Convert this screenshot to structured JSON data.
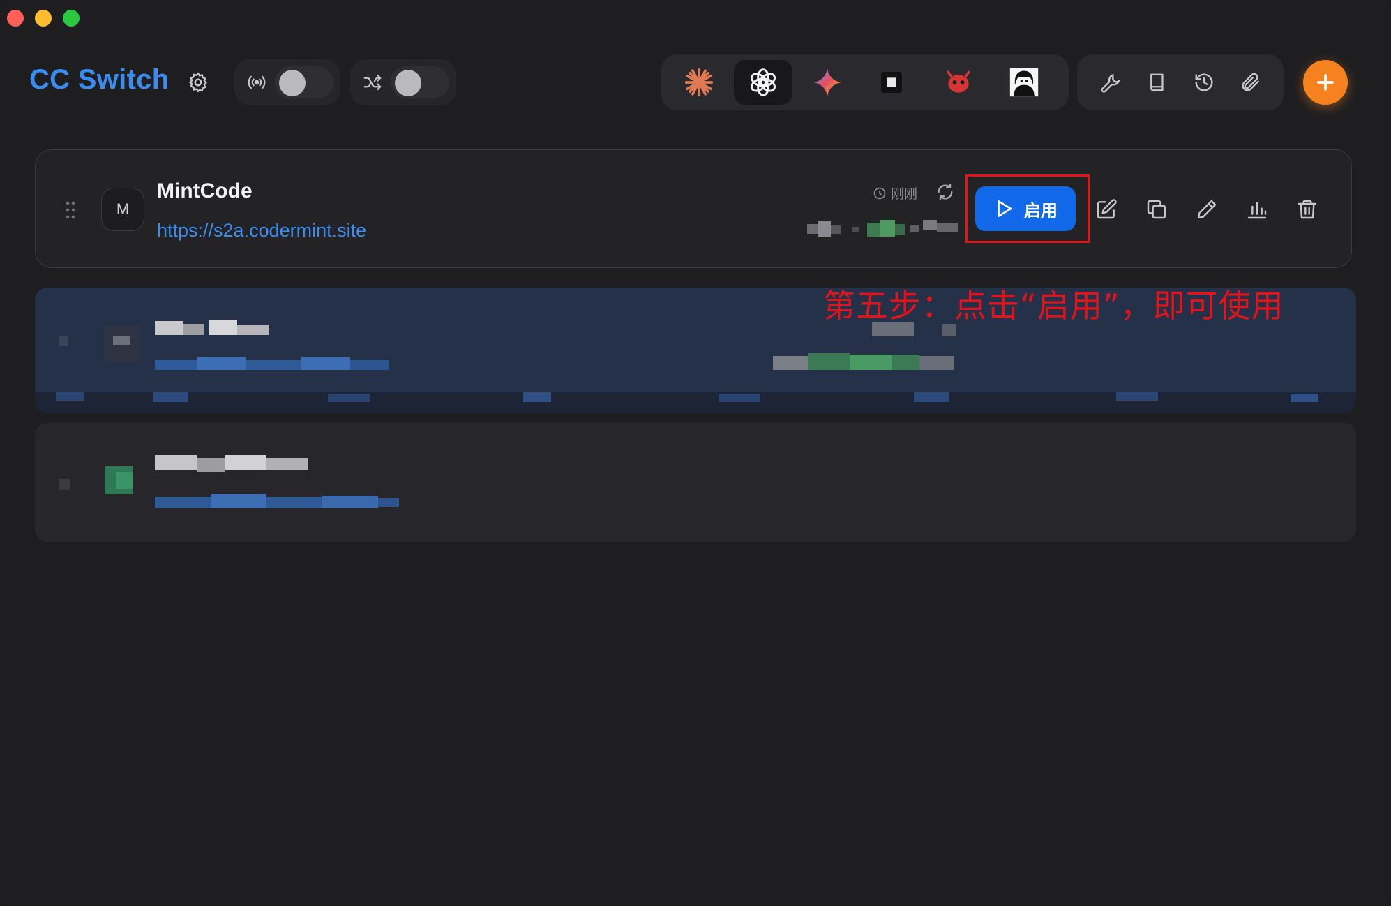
{
  "window": {
    "traffic_lights": [
      "close",
      "minimize",
      "zoom"
    ]
  },
  "header": {
    "app_title": "CC Switch",
    "settings_icon": "gear-icon",
    "toggles": [
      {
        "icon": "broadcast-icon",
        "state": "off"
      },
      {
        "icon": "shuffle-icon",
        "state": "off"
      }
    ],
    "providers": [
      {
        "name": "claude",
        "icon": "claude-burst-icon",
        "active": false
      },
      {
        "name": "openai",
        "icon": "openai-knot-icon",
        "active": true
      },
      {
        "name": "gemini",
        "icon": "gemini-sparkle-icon",
        "active": false
      },
      {
        "name": "square",
        "icon": "square-app-icon",
        "active": false
      },
      {
        "name": "red-bot",
        "icon": "red-bot-icon",
        "active": false
      },
      {
        "name": "portrait",
        "icon": "portrait-icon",
        "active": false
      }
    ],
    "tools": [
      "wrench-icon",
      "book-icon",
      "history-icon",
      "paperclip-icon"
    ],
    "add_label": "+"
  },
  "cards": [
    {
      "avatar_letter": "M",
      "name": "MintCode",
      "url": "https://s2a.codermint.site",
      "last_checked": "刚刚",
      "enable_label": "启用",
      "actions": [
        "edit-icon",
        "copy-icon",
        "pen-icon",
        "stats-icon",
        "trash-icon"
      ]
    }
  ],
  "annotation": "第五步：点击“启用”，即可使用",
  "colors": {
    "background": "#1e1e20",
    "accent_blue": "#3b8cf0",
    "enable_button": "#1168e8",
    "add_button": "#f5821f",
    "annotation_red": "#e0141a"
  }
}
